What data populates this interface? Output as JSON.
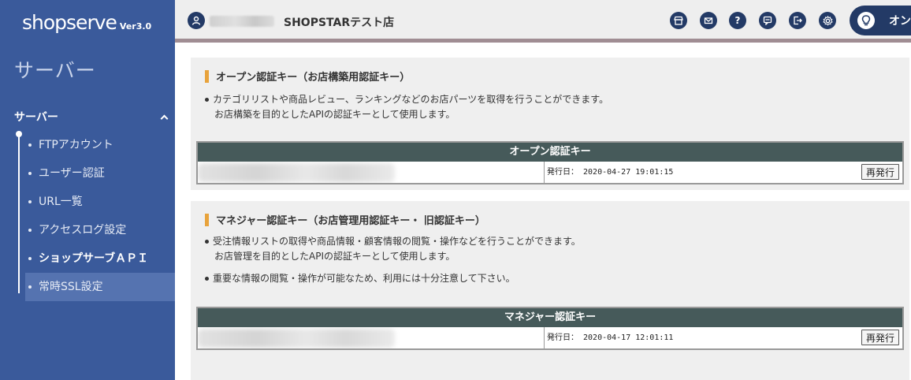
{
  "sidebar": {
    "logo": "shopserve",
    "logo_version": "Ver3.0",
    "title": "サーバー",
    "section_label": "サーバー",
    "items": [
      {
        "label": "FTPアカウント"
      },
      {
        "label": "ユーザー認証"
      },
      {
        "label": "URL一覧"
      },
      {
        "label": "アクセスログ設定"
      },
      {
        "label": "ショップサーブＡＰＩ"
      },
      {
        "label": "常時SSL設定"
      }
    ]
  },
  "header": {
    "store_name": "SHOPSTARテスト店",
    "online_label": "オン"
  },
  "panels": [
    {
      "title": "オープン認証キー（お店構築用認証キー）",
      "desc": [
        "カテゴリリストや商品レビュー、ランキングなどのお店パーツを取得を行うことができます。",
        "お店構築を目的としたAPIの認証キーとして使用します。"
      ],
      "table_header": "オープン認証キー",
      "date_label": "発行日： 2020-04-27 19:01:15",
      "button_label": "再発行"
    },
    {
      "title": "マネジャー認証キー（お店管理用認証キー・ 旧認証キー）",
      "desc": [
        "受注情報リストの取得や商品情報・顧客情報の閲覧・操作などを行うことができます。",
        "お店管理を目的としたAPIの認証キーとして使用します。",
        "重要な情報の閲覧・操作が可能なため、利用には十分注意して下さい。"
      ],
      "table_header": "マネジャー認証キー",
      "date_label": "発行日： 2020-04-17 12:01:11",
      "button_label": "再発行"
    }
  ]
}
